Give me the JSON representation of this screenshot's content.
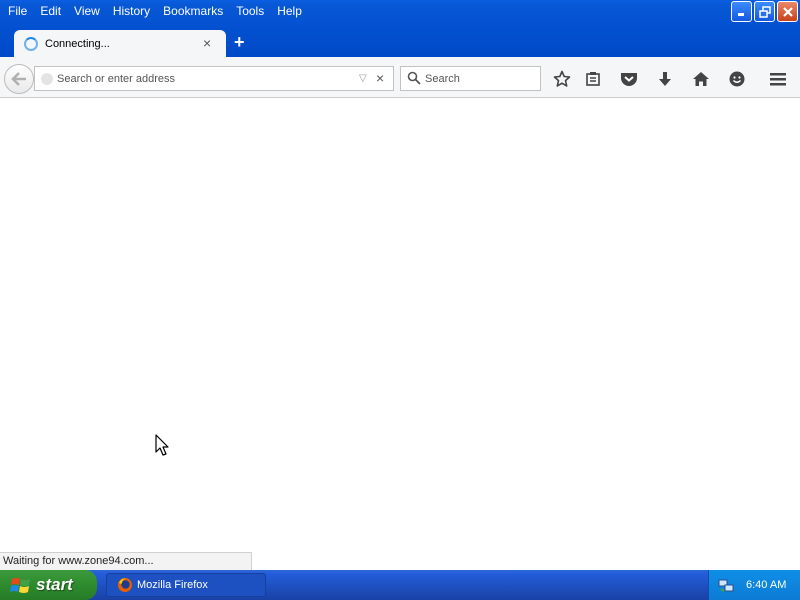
{
  "menu": {
    "items": [
      {
        "label": "File"
      },
      {
        "label": "Edit"
      },
      {
        "label": "View"
      },
      {
        "label": "History"
      },
      {
        "label": "Bookmarks"
      },
      {
        "label": "Tools"
      },
      {
        "label": "Help"
      }
    ]
  },
  "tab": {
    "title": "Connecting...",
    "close_glyph": "×",
    "new_tab_glyph": "+"
  },
  "navbar": {
    "url_placeholder": "Search or enter address",
    "url_value": "",
    "url_stop_glyph": "×",
    "url_dropmarker_glyph": "▽",
    "search_placeholder": "Search",
    "icons": [
      "bookmark-star-icon",
      "reading-list-icon",
      "pocket-icon",
      "downloads-icon",
      "home-icon",
      "hello-icon",
      "hamburger-menu-icon"
    ]
  },
  "status": {
    "text": "Waiting for www.zone94.com..."
  },
  "taskbar": {
    "start_label": "start",
    "task_label": "Mozilla Firefox",
    "clock": "6:40 AM"
  },
  "colors": {
    "xp_blue": "#0351d0",
    "start_green": "#2e8b2e",
    "tray_blue": "#0c7bd4",
    "spinner_blue": "#1e8ae8"
  }
}
